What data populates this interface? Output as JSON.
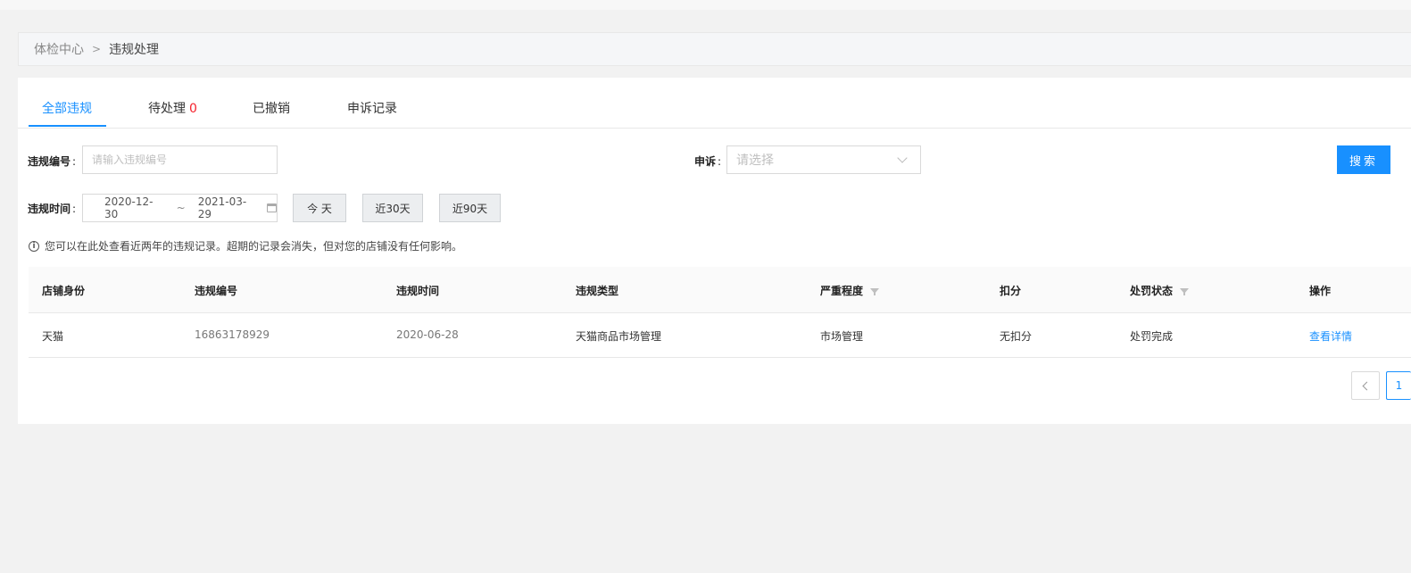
{
  "breadcrumb": {
    "root": "体检中心",
    "separator": ">",
    "current": "违规处理"
  },
  "tabs": [
    {
      "label": "全部违规",
      "active": true
    },
    {
      "label": "待处理",
      "count": "0"
    },
    {
      "label": "已撤销"
    },
    {
      "label": "申诉记录"
    }
  ],
  "filters": {
    "violation_no": {
      "label": "违规编号",
      "placeholder": "请输入违规编号"
    },
    "appeal": {
      "label": "申诉",
      "placeholder": "请选择"
    },
    "violation_time": {
      "label": "违规时间",
      "start": "2020-12-30",
      "tilde": "~",
      "end": "2021-03-29"
    },
    "colon": ":",
    "quick": [
      "今 天",
      "近30天",
      "近90天"
    ],
    "search_label": "搜索"
  },
  "notice": {
    "icon_glyph": "i",
    "text": "您可以在此处查看近两年的违规记录。超期的记录会消失，但对您的店铺没有任何影响。"
  },
  "table": {
    "headers": [
      "店铺身份",
      "违规编号",
      "违规时间",
      "违规类型",
      "严重程度",
      "扣分",
      "处罚状态",
      "操作"
    ],
    "rows": [
      [
        "天猫",
        "16863178929",
        "2020-06-28",
        "天猫商品市场管理",
        "市场管理",
        "无扣分",
        "处罚完成",
        "查看详情"
      ]
    ]
  },
  "pagination": {
    "current": "1"
  },
  "icons": [
    "info-icon",
    "calendar-icon",
    "chevron-down-icon",
    "filter-icon",
    "chevron-left-icon"
  ],
  "colors": {
    "accent": "#1890ff",
    "danger": "#f5222d"
  }
}
